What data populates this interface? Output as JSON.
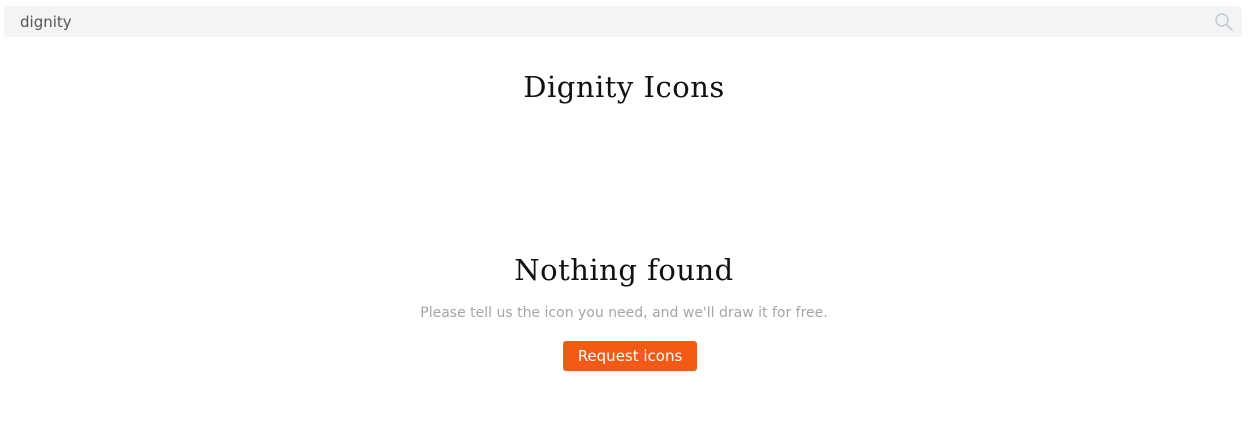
{
  "search": {
    "value": "dignity",
    "icon": "search-icon"
  },
  "header": {
    "title": "Dignity Icons"
  },
  "empty_state": {
    "title": "Nothing found",
    "subtitle": "Please tell us the icon you need, and we'll draw it for free.",
    "button_label": "Request icons"
  },
  "colors": {
    "accent": "#f25a16",
    "search_background": "#f3f4f6",
    "muted_text": "#a6a6a6"
  }
}
